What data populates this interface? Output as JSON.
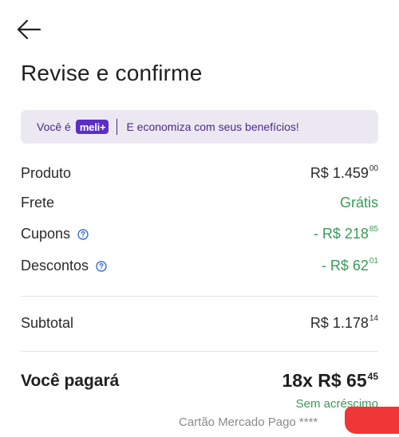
{
  "header": {
    "title": "Revise e confirme"
  },
  "banner": {
    "prefix": "Você é",
    "badge": "meli+",
    "text": "E economiza com seus benefícios!"
  },
  "summary": {
    "product": {
      "label": "Produto",
      "main": "R$ 1.459",
      "cents": "00"
    },
    "shipping": {
      "label": "Frete",
      "value": "Grátis"
    },
    "coupons": {
      "label": "Cupons",
      "main": "- R$ 218",
      "cents": "85",
      "help_icon": "question-circle"
    },
    "discounts": {
      "label": "Descontos",
      "main": "- R$ 62",
      "cents": "01",
      "help_icon": "question-circle"
    },
    "subtotal": {
      "label": "Subtotal",
      "main": "R$ 1.178",
      "cents": "14"
    }
  },
  "total": {
    "label": "Você pagará",
    "main": "18x R$ 65",
    "cents": "45",
    "note": "Sem acréscimo"
  },
  "payment": {
    "method": "Cartão Mercado Pago ****"
  },
  "colors": {
    "accent_green": "#3a9a57",
    "banner_bg": "#ebe8f2",
    "banner_text": "#4a2a8a",
    "meli_badge": "#5b2ec4",
    "help_icon_blue": "#3b6fe0"
  }
}
